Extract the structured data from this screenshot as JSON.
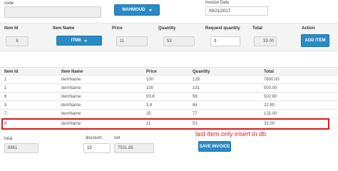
{
  "top": {
    "code_label": "code",
    "customer_button": "MAHMOUD",
    "invoice_date_label": "Invoice Date",
    "invoice_date_value": "09/21/2017"
  },
  "entry": {
    "headers": {
      "item_id": "Item Id",
      "item_name": "Item Name",
      "price": "Price",
      "quantity": "Quantity",
      "request_quantity": "Request quantity",
      "total": "Total",
      "action": "Action"
    },
    "item_id": "8",
    "item_select": "ITM8",
    "price": "11",
    "quantity": "53",
    "request_quantity": "3",
    "total": "33.00",
    "add_button": "ADD ITEM"
  },
  "table": {
    "headers": [
      "Item Id",
      "Item Name",
      "Price",
      "Quantity",
      "Total"
    ],
    "rows": [
      {
        "id": "1",
        "name": "itemName",
        "price": "100",
        "quantity": "126",
        "total": "7600.00"
      },
      {
        "id": "1",
        "name": "itemName",
        "price": "100",
        "quantity": "131",
        "total": "500.00"
      },
      {
        "id": "6",
        "name": "itemName",
        "price": "93.8",
        "quantity": "56",
        "total": "502.80"
      },
      {
        "id": "5",
        "name": "itemName",
        "price": "3.8",
        "quantity": "84",
        "total": "22.80"
      },
      {
        "id": "7",
        "name": "itemName",
        "price": "25",
        "quantity": "77",
        "total": "125.00"
      },
      {
        "id": "8",
        "name": "itemName",
        "price": "11",
        "quantity": "53",
        "total": "33.00"
      }
    ]
  },
  "annotation": "last item only insert in db",
  "footer": {
    "total_label": "total",
    "total_value": "8861",
    "discount_label": "discount",
    "discount_value": "15",
    "net_label": "net",
    "net_value": "7531.85",
    "save_button": "SAVE INVOICE"
  },
  "colors": {
    "accent": "#2a8ac4",
    "highlight": "#d81f1f"
  },
  "icons": {
    "dropdown": "caret-down-icon"
  }
}
